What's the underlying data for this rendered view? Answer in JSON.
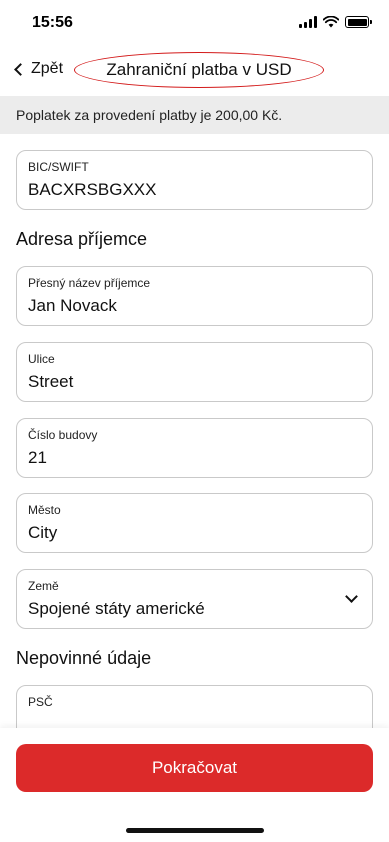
{
  "status_bar": {
    "time": "15:56"
  },
  "nav": {
    "back_label": "Zpět",
    "title": "Zahraniční platba v USD"
  },
  "fee_banner": "Poplatek za provedení platby je 200,00 Kč.",
  "bic": {
    "label": "BIC/SWIFT",
    "value": "BACXRSBGXXX"
  },
  "recipient_address": {
    "heading": "Adresa příjemce",
    "name": {
      "label": "Přesný název příjemce",
      "value": "Jan Novack"
    },
    "street": {
      "label": "Ulice",
      "value": "Street"
    },
    "building_number": {
      "label": "Číslo budovy",
      "value": "21"
    },
    "city": {
      "label": "Město",
      "value": "City"
    },
    "country": {
      "label": "Země",
      "value": "Spojené státy americké"
    }
  },
  "optional": {
    "heading": "Nepovinné údaje",
    "postal_code": {
      "label": "PSČ",
      "value": ""
    }
  },
  "footer": {
    "continue_label": "Pokračovat"
  },
  "colors": {
    "accent": "#dc2a2a",
    "banner_bg": "#ececec",
    "field_border": "#c9c9c9"
  },
  "icons": {
    "back": "chevron-left-icon",
    "dropdown": "chevron-down-icon"
  }
}
